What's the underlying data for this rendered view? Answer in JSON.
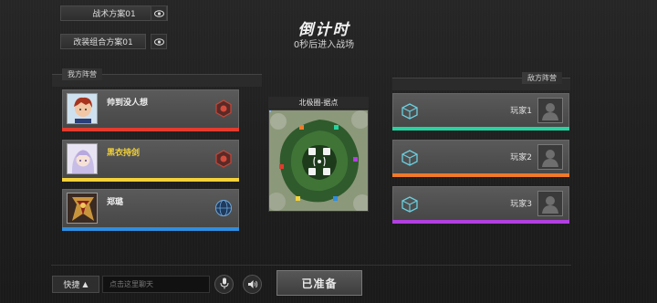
{
  "schemes": {
    "tactical": "战术方案01",
    "mod_combo": "改装组合方案01"
  },
  "countdown": {
    "title": "倒计时",
    "subtitle": "0秒后进入战场"
  },
  "sections": {
    "ally": "我方阵营",
    "enemy": "敌方阵营"
  },
  "allies": [
    {
      "name": "帅到没人想",
      "name_color": "#f0f0f0",
      "bar_color": "#e33b2e",
      "badge": "red-hex-emblem-icon"
    },
    {
      "name": "黑衣持剑",
      "name_color": "#f4d23a",
      "bar_color": "#f4d23a",
      "badge": "red-hex-emblem-icon"
    },
    {
      "name": "郑璐",
      "name_color": "#f0f0f0",
      "bar_color": "#2f8ee0",
      "badge": "globe-emblem-icon"
    }
  ],
  "enemies": [
    {
      "name": "玩家1",
      "bar_color": "#26d3a0"
    },
    {
      "name": "玩家2",
      "bar_color": "#f07a2a"
    },
    {
      "name": "玩家3",
      "bar_color": "#b23fe0"
    }
  ],
  "map": {
    "title": "北极圈-据点"
  },
  "bottom": {
    "quick_label": "快捷",
    "chat_placeholder": "点击这里聊天",
    "ready_label": "已准备"
  }
}
